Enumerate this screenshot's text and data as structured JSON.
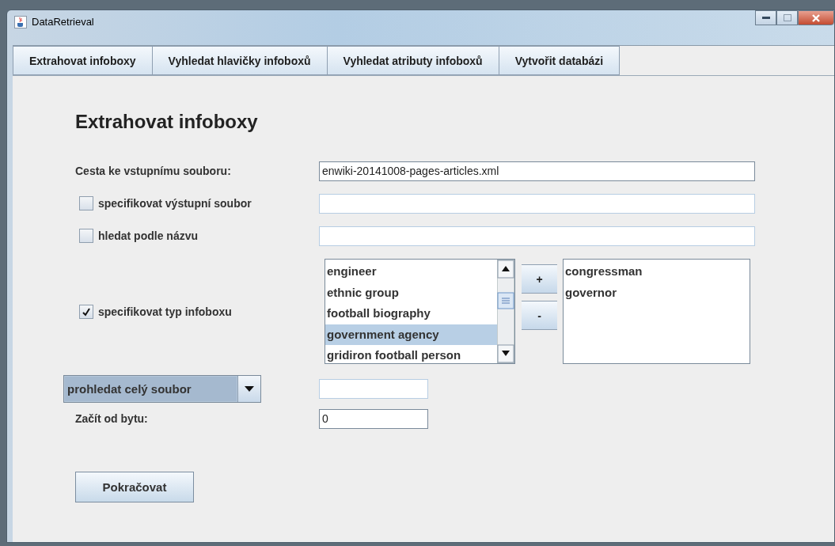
{
  "window": {
    "title": "DataRetrieval"
  },
  "tabs": [
    {
      "label": "Extrahovat infoboxy"
    },
    {
      "label": "Vyhledat hlavičky infoboxů"
    },
    {
      "label": "Vyhledat atributy infoboxů"
    },
    {
      "label": "Vytvořit databázi"
    }
  ],
  "heading": "Extrahovat infoboxy",
  "input_file": {
    "label": "Cesta ke vstupnímu souboru:",
    "value": "enwiki-20141008-pages-articles.xml"
  },
  "options": [
    {
      "label": "specifikovat výstupní soubor",
      "checked": false
    },
    {
      "label": "hledat podle názvu",
      "checked": false
    }
  ],
  "type_option": {
    "label": "specifikovat typ infoboxu",
    "checked": true
  },
  "available_types": [
    {
      "label": "engineer",
      "selected": false
    },
    {
      "label": "ethnic group",
      "selected": false
    },
    {
      "label": "football biography",
      "selected": false
    },
    {
      "label": "government agency",
      "selected": true
    },
    {
      "label": "gridiron football person",
      "selected": false
    }
  ],
  "add_button": "+",
  "remove_button": "-",
  "chosen_types": [
    "congressman",
    "governor"
  ],
  "mode_combo": {
    "value": "prohledat celý soubor"
  },
  "start_byte": {
    "label": "Začít od bytu:",
    "value": "0"
  },
  "continue_button": "Pokračovat"
}
